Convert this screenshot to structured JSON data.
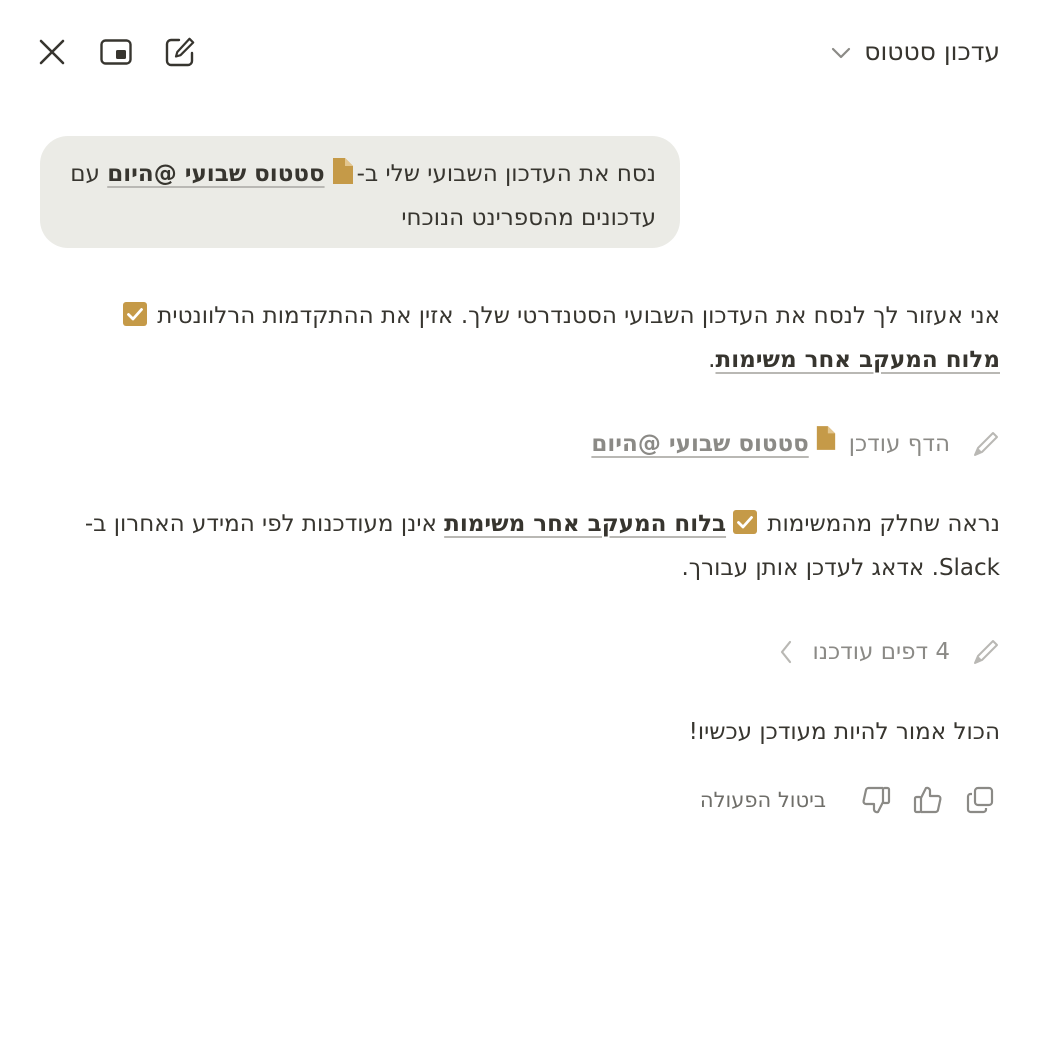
{
  "header": {
    "title": "עדכון סטטוס",
    "chevron_icon": "chevron-down-icon",
    "actions": [
      "close-icon",
      "picture-in-picture-icon",
      "new-chat-icon"
    ]
  },
  "user_message": {
    "text_before": "נסח את העדכון השבועי שלי ב-",
    "page_link": "סטטוס שבועי @היום",
    "text_after": " עם עדכונים מהספרינט הנוכחי",
    "page_icon": "document-icon"
  },
  "assistant": {
    "intro_before": "אני אעזור לך לנסח את העדכון השבועי הסטנדרטי שלך. אזין את ההתקדמות הרלוונטית ",
    "intro_link": "מלוח המעקב אחר משימות",
    "intro_after": ".",
    "step1_label": "הדף עודכן",
    "step1_link": "סטטוס שבועי @היום",
    "msg2_before": "נראה שחלק מהמשימות ",
    "msg2_link": "בלוח המעקב אחר משימות",
    "msg2_after": " אינן מעודכנות לפי המידע האחרון ב-Slack. אדאג לעדכן אותן עבורך.",
    "step2_label": "4 דפים עודכנו",
    "final_message": "הכול אמור להיות מעודכן עכשיו!"
  },
  "feedback": {
    "undo_label": "ביטול הפעולה",
    "icons": [
      "copy-icon",
      "thumbs-up-icon",
      "thumbs-down-icon"
    ]
  },
  "colors": {
    "accent": "#c59a48",
    "bubble_bg": "#ebebe6",
    "text": "#37352f",
    "muted": "#8b8a86"
  }
}
